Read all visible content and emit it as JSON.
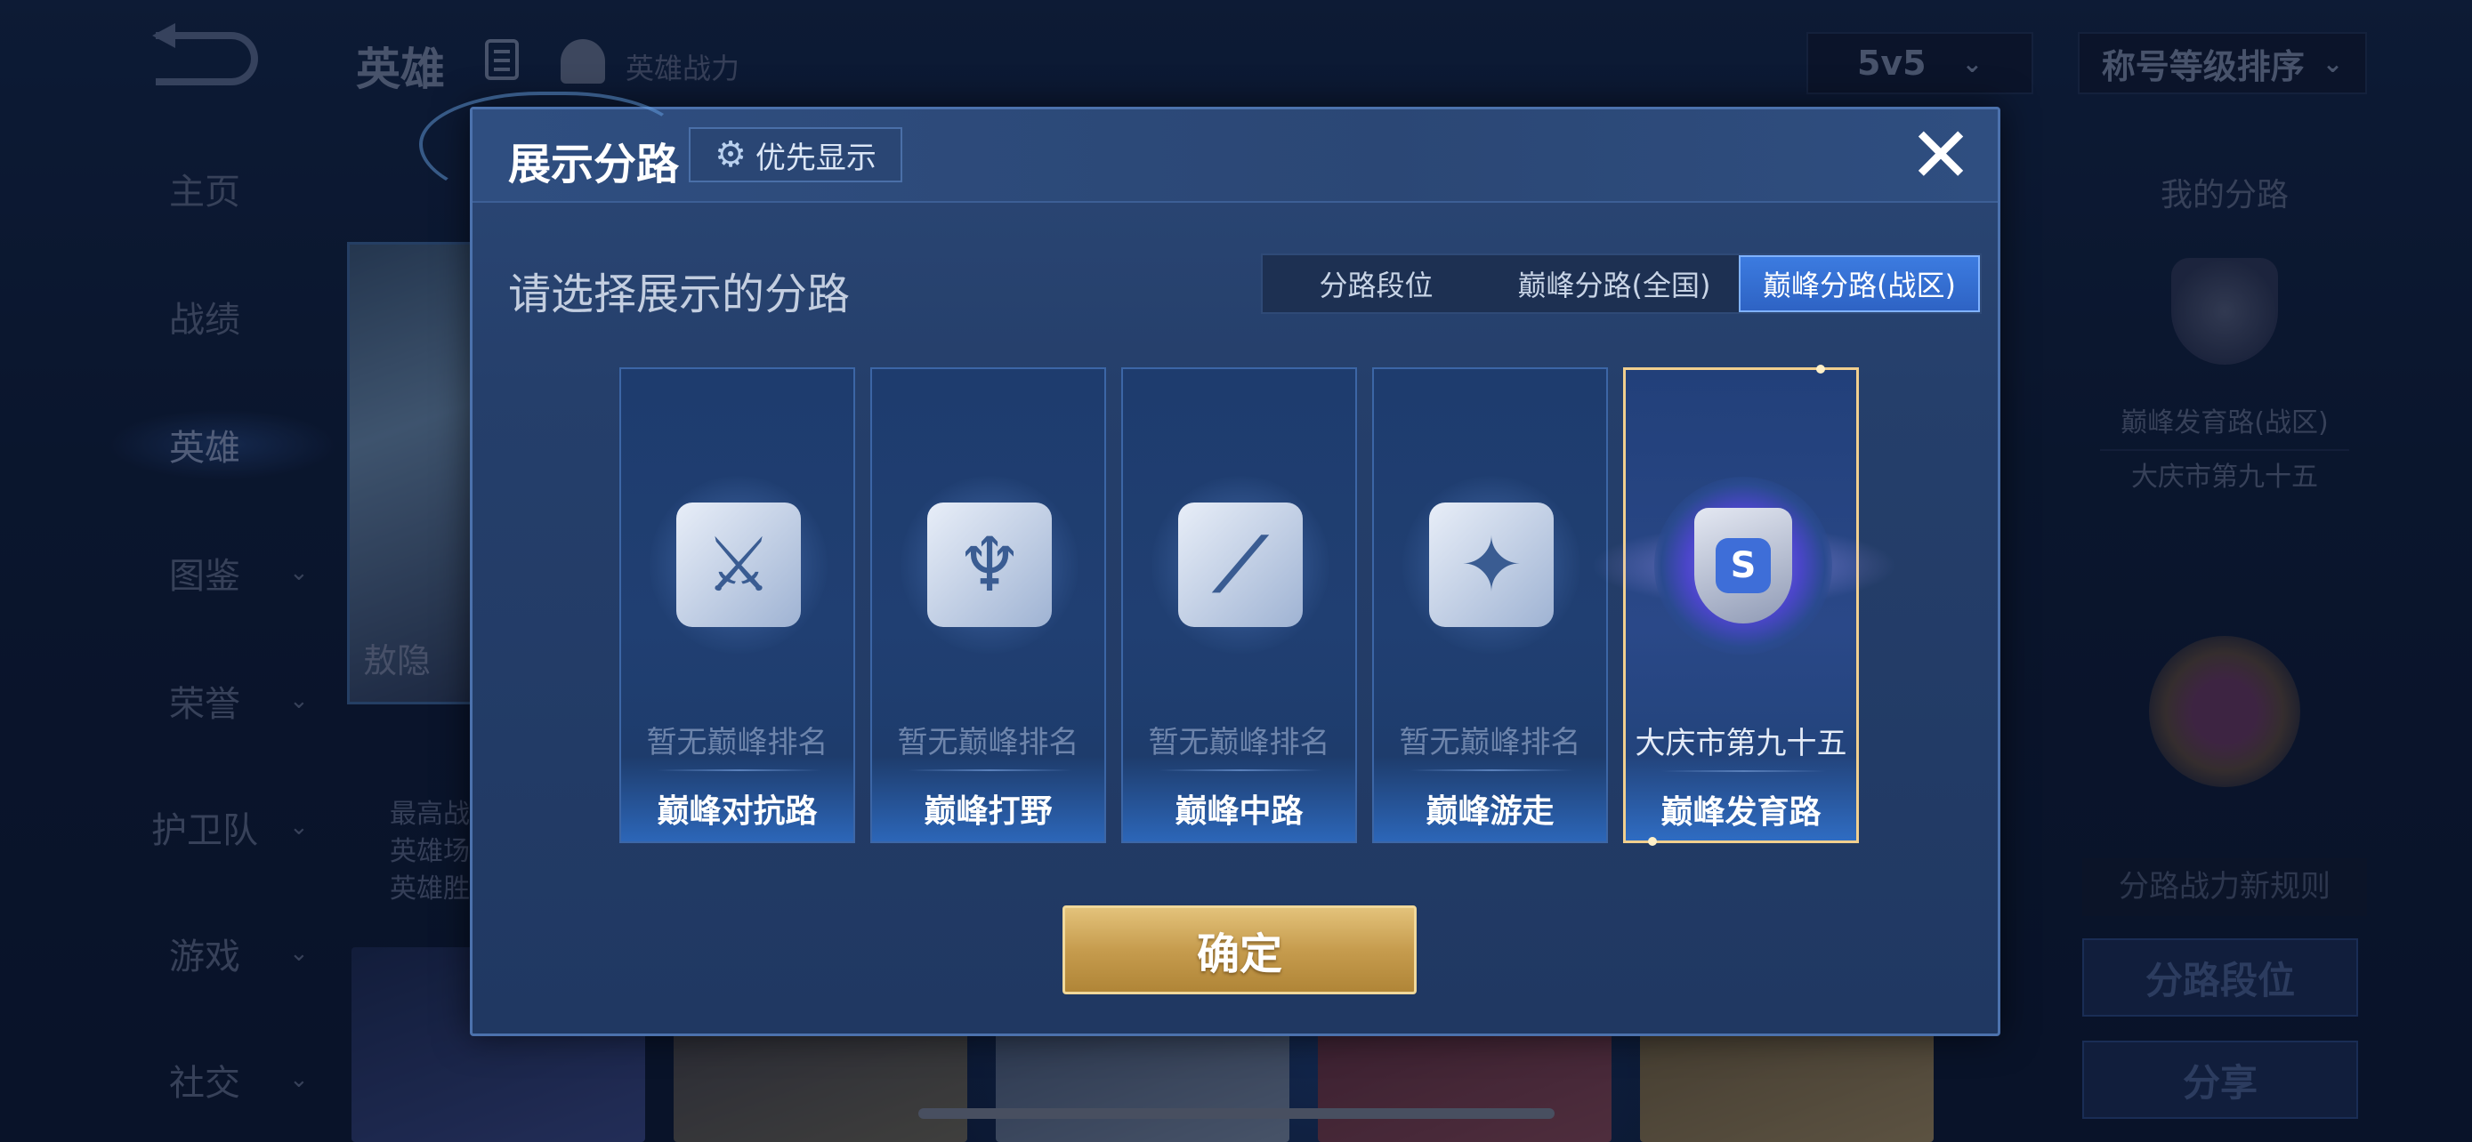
{
  "background": {
    "page_title": "英雄",
    "power_label": "英雄战力",
    "mode_select": "5v5",
    "sort_select": "称号等级排序",
    "sidebar": [
      "主页",
      "战绩",
      "英雄",
      "图鉴",
      "荣誉",
      "护卫队",
      "游戏",
      "社交"
    ],
    "active_sidebar": "英雄",
    "hero_name": "敖隐",
    "hero_stats": [
      "最高战",
      "英雄场",
      "英雄胜"
    ],
    "right_panel": {
      "title": "我的分路",
      "badge_label": "巅峰发育路(战区)",
      "city": "大庆市第九十五",
      "rules": "分路战力新规则",
      "lane_rank_button": "分路段位",
      "share_button": "分享"
    }
  },
  "modal": {
    "title": "展示分路",
    "priority_button": "优先显示",
    "subtitle": "请选择展示的分路",
    "tabs": [
      {
        "label": "分路段位",
        "active": false
      },
      {
        "label": "巅峰分路(全国)",
        "active": false
      },
      {
        "label": "巅峰分路(战区)",
        "active": true
      }
    ],
    "lanes": [
      {
        "name": "巅峰对抗路",
        "rank": "暂无巅峰排名",
        "icon": "sword-lane-icon",
        "selected": false
      },
      {
        "name": "巅峰打野",
        "rank": "暂无巅峰排名",
        "icon": "dragon-jungle-icon",
        "selected": false
      },
      {
        "name": "巅峰中路",
        "rank": "暂无巅峰排名",
        "icon": "staff-mid-icon",
        "selected": false
      },
      {
        "name": "巅峰游走",
        "rank": "暂无巅峰排名",
        "icon": "wings-support-icon",
        "selected": false
      },
      {
        "name": "巅峰发育路",
        "rank": "大庆市第九十五",
        "icon": "winged-shield-icon",
        "selected": true
      }
    ],
    "confirm_button": "确定"
  },
  "colors": {
    "modal_bg": "#253f6b",
    "tab_active": "#3c7be0",
    "selected_border": "#f1cf8e",
    "confirm_gold": "#c69c4e"
  }
}
